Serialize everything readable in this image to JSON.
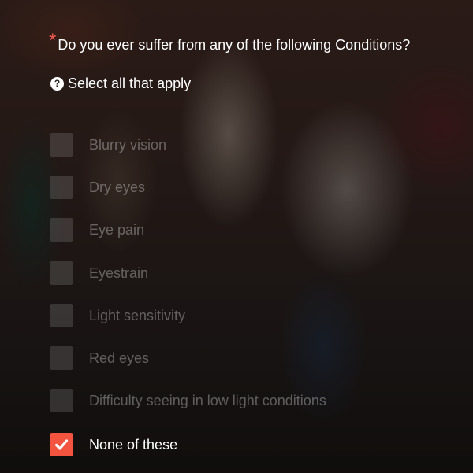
{
  "question": {
    "required_marker": "*",
    "text": "Do you ever suffer from any of the following Conditions?"
  },
  "hint": {
    "icon": "question-circle-icon",
    "text": "Select all that apply"
  },
  "options": [
    {
      "label": "Blurry vision",
      "checked": false
    },
    {
      "label": "Dry eyes",
      "checked": false
    },
    {
      "label": "Eye pain",
      "checked": false
    },
    {
      "label": "Eyestrain",
      "checked": false
    },
    {
      "label": "Light sensitivity",
      "checked": false
    },
    {
      "label": "Red eyes",
      "checked": false
    },
    {
      "label": "Difficulty seeing in low light conditions",
      "checked": false
    },
    {
      "label": "None of these",
      "checked": true
    }
  ],
  "colors": {
    "accent": "#f2543f",
    "required": "#ef5a4f"
  }
}
